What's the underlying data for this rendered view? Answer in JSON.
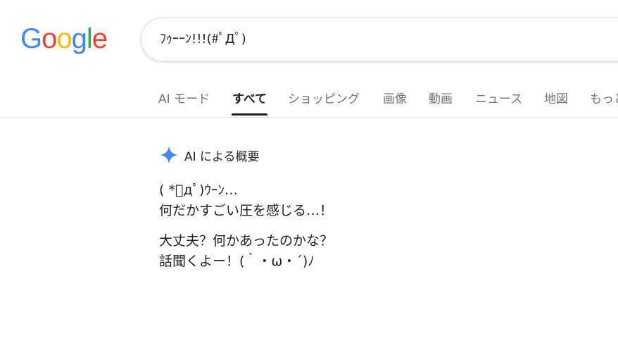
{
  "logo": {
    "letters": [
      "G",
      "o",
      "o",
      "g",
      "l",
      "e"
    ],
    "colors": [
      "#4285F4",
      "#EA4335",
      "#FBBC05",
      "#4285F4",
      "#34A853",
      "#EA4335"
    ]
  },
  "search": {
    "value": "ﾌｩｰｰﾝ!!!(#ﾟДﾟ)"
  },
  "tabs": [
    {
      "label": "AI モード"
    },
    {
      "label": "すべて"
    },
    {
      "label": "ショッピング"
    },
    {
      "label": "画像"
    },
    {
      "label": "動画"
    },
    {
      "label": "ニュース"
    },
    {
      "label": "地図"
    },
    {
      "label": "もっと"
    }
  ],
  "active_tab_color": "#202124",
  "ai_overview": {
    "icon": "sparkle-icon",
    "icon_color": "#4285F4",
    "title": "AI による概要",
    "paragraphs": [
      [
        "( *ﾟдﾟ)ｳｰﾝ…",
        "何だかすごい圧を感じる…！"
      ],
      [
        "大丈夫？何かあったのかな？",
        "話聞くよー！(｀・ω・´)ﾉ"
      ]
    ]
  }
}
